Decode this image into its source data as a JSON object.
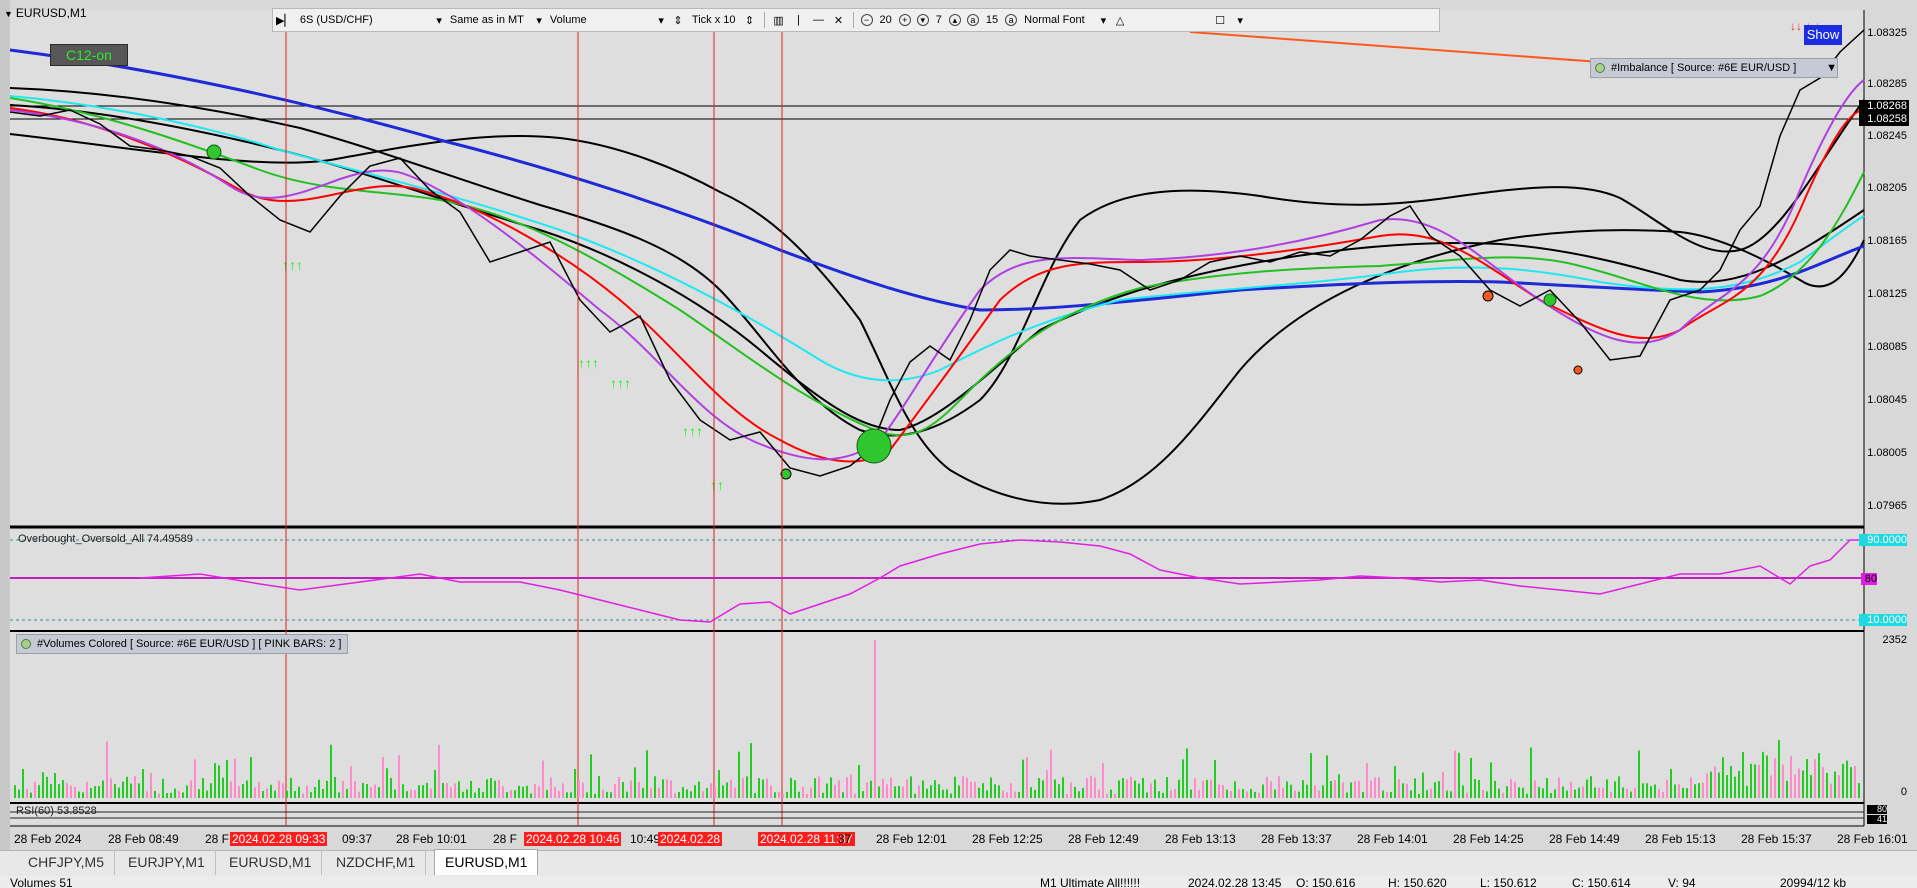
{
  "window": {
    "title": "EURUSD,M1",
    "c12_badge": "C12-on",
    "show_button": "Show"
  },
  "toolbar": {
    "symbol": "6S (USD/CHF)",
    "session": "Same as in MT",
    "mode": "Volume",
    "tick_label": "Tick x 10",
    "val1": "20",
    "val2": "7",
    "val3": "15",
    "font": "Normal Font"
  },
  "indicators": {
    "imbalance_label": "#Imbalance [ Source: #6E EUR/USD ]",
    "overbought_label": "Overbought_Oversold_All 74.49589",
    "volumes_label": "#Volumes Colored [ Source: #6E EUR/USD ]  [ PINK BARS: 2 ]",
    "rsi_label": "RSI(60) 53.8528"
  },
  "price_axis": {
    "labels": [
      "1.08325",
      "1.08285",
      "1.08245",
      "1.08205",
      "1.08165",
      "1.08125",
      "1.08085",
      "1.08045",
      "1.08005",
      "1.07965"
    ],
    "current_1": "1.08268",
    "current_2": "1.08258",
    "osc_high": "90.0000",
    "osc_mid": "80",
    "osc_low": "10.0000",
    "vol_max": "2352",
    "vol_zero": "0",
    "rsi_a": "80",
    "rsi_b": "41"
  },
  "time_axis": {
    "labels": [
      "28 Feb 2024",
      "28 Feb 08:49",
      "28 F",
      "09:37",
      "28 Feb 10:01",
      "28 F",
      "10:49",
      "37",
      "28 Feb 12:01",
      "28 Feb 12:25",
      "28 Feb 12:49",
      "28 Feb 13:13",
      "28 Feb 13:37",
      "28 Feb 14:01",
      "28 Feb 14:25",
      "28 Feb 14:49",
      "28 Feb 15:13",
      "28 Feb 15:37",
      "28 Feb 16:01"
    ],
    "red_markers": [
      "2024.02.28 09:33",
      "2024.02.28 10:46",
      "2024.02.28",
      "2024.02.28 11:37"
    ]
  },
  "tabs": [
    "CHFJPY,M5",
    "EURJPY,M1",
    "EURUSD,M1",
    "NZDCHF,M1",
    "EURUSD,M1"
  ],
  "status_bar": {
    "ohlc_1": "Volumes 51",
    "preset": "M1 Ultimate All!!!!!!",
    "datetime": "2024.02.28 13:45",
    "open": "O: 150.616",
    "high": "H: 150.620",
    "low": "L: 150.612",
    "close": "C: 150.614",
    "volume": "V: 94",
    "traffic": "20994/12 kb"
  },
  "colors": {
    "candle_up": "#000000",
    "ma_red": "#ff0000",
    "ma_green": "#22c022",
    "ma_cyan": "#20e8f0",
    "ma_blue": "#1e2ad6",
    "ma_purple": "#b040e0",
    "osc_line": "#e020e0",
    "vol_green": "#22cc22",
    "vol_pink": "#ff8cc8",
    "marker_red": "#ff1e1e",
    "up_arrow": "#22ee22"
  }
}
